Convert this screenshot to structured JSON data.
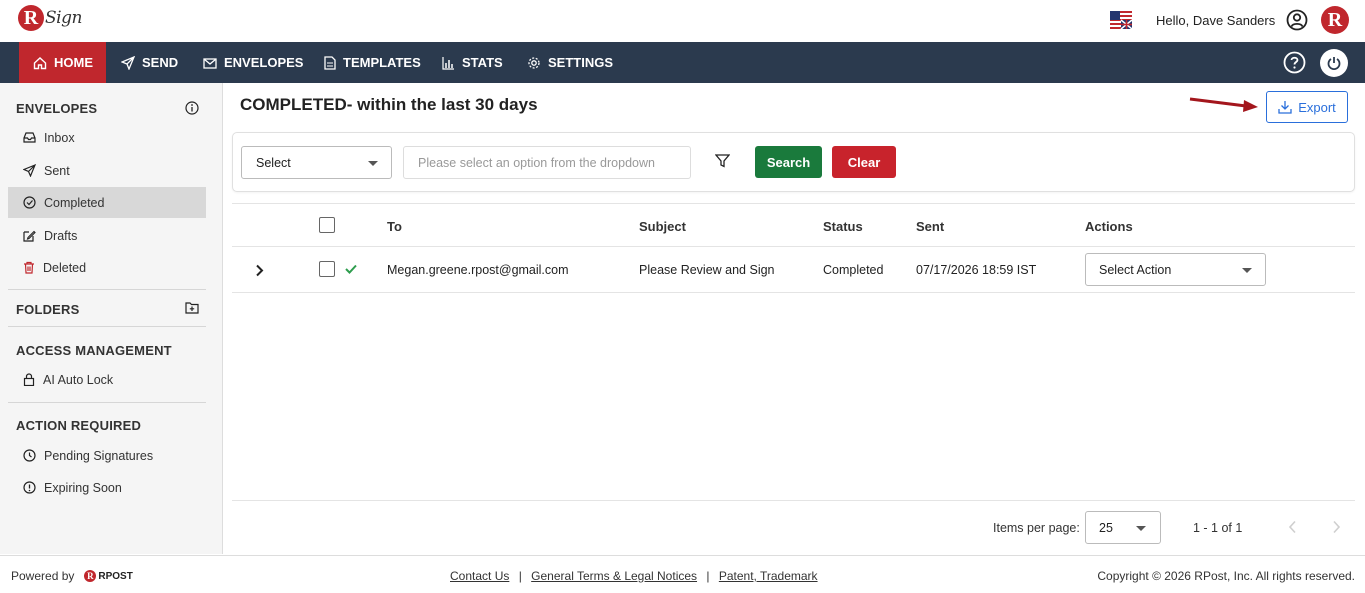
{
  "header": {
    "brand_letter": "R",
    "brand_text": "Sign",
    "greeting": "Hello, Dave Sanders",
    "brand_badge": "R"
  },
  "nav": {
    "items": [
      {
        "label": "HOME",
        "icon": "home-icon",
        "active": true
      },
      {
        "label": "SEND",
        "icon": "send-icon"
      },
      {
        "label": "ENVELOPES",
        "icon": "envelope-icon"
      },
      {
        "label": "TEMPLATES",
        "icon": "document-icon"
      },
      {
        "label": "STATS",
        "icon": "bar-chart-icon"
      },
      {
        "label": "SETTINGS",
        "icon": "gear-icon"
      }
    ]
  },
  "sidebar": {
    "envelopes_heading": "ENVELOPES",
    "envelopes": [
      {
        "label": "Inbox",
        "icon": "inbox-icon"
      },
      {
        "label": "Sent",
        "icon": "send-icon"
      },
      {
        "label": "Completed",
        "icon": "check-circle-icon",
        "active": true
      },
      {
        "label": "Drafts",
        "icon": "edit-icon"
      },
      {
        "label": "Deleted",
        "icon": "trash-icon"
      }
    ],
    "folders_heading": "FOLDERS",
    "access_heading": "ACCESS MANAGEMENT",
    "access_items": [
      {
        "label": "AI Auto Lock",
        "icon": "lock-icon"
      }
    ],
    "action_heading": "ACTION REQUIRED",
    "action_items": [
      {
        "label": "Pending Signatures",
        "icon": "clock-icon"
      },
      {
        "label": "Expiring Soon",
        "icon": "alert-icon"
      }
    ]
  },
  "main": {
    "title": "COMPLETED- within the last 30 days",
    "export_label": "Export",
    "filter": {
      "select_value": "Select",
      "input_placeholder": "Please select an option from the dropdown",
      "search_label": "Search",
      "clear_label": "Clear"
    },
    "table": {
      "columns": [
        "To",
        "Subject",
        "Status",
        "Sent",
        "Actions"
      ],
      "rows": [
        {
          "to": "Megan.greene.rpost@gmail.com",
          "subject": "Please Review and Sign",
          "status": "Completed",
          "sent": "07/17/2026 18:59 IST",
          "action": "Select Action"
        }
      ]
    },
    "pagination": {
      "items_per_page_label": "Items per page:",
      "items_per_page": "25",
      "range": "1 - 1 of 1"
    }
  },
  "footer": {
    "powered_by": "Powered by",
    "rpost_brand": "RPOST",
    "rpost_letter": "R",
    "links": [
      "Contact Us",
      "General Terms & Legal Notices",
      "Patent, Trademark"
    ],
    "separator": "|",
    "copyright": "Copyright © 2026 RPost, Inc. All rights reserved."
  }
}
